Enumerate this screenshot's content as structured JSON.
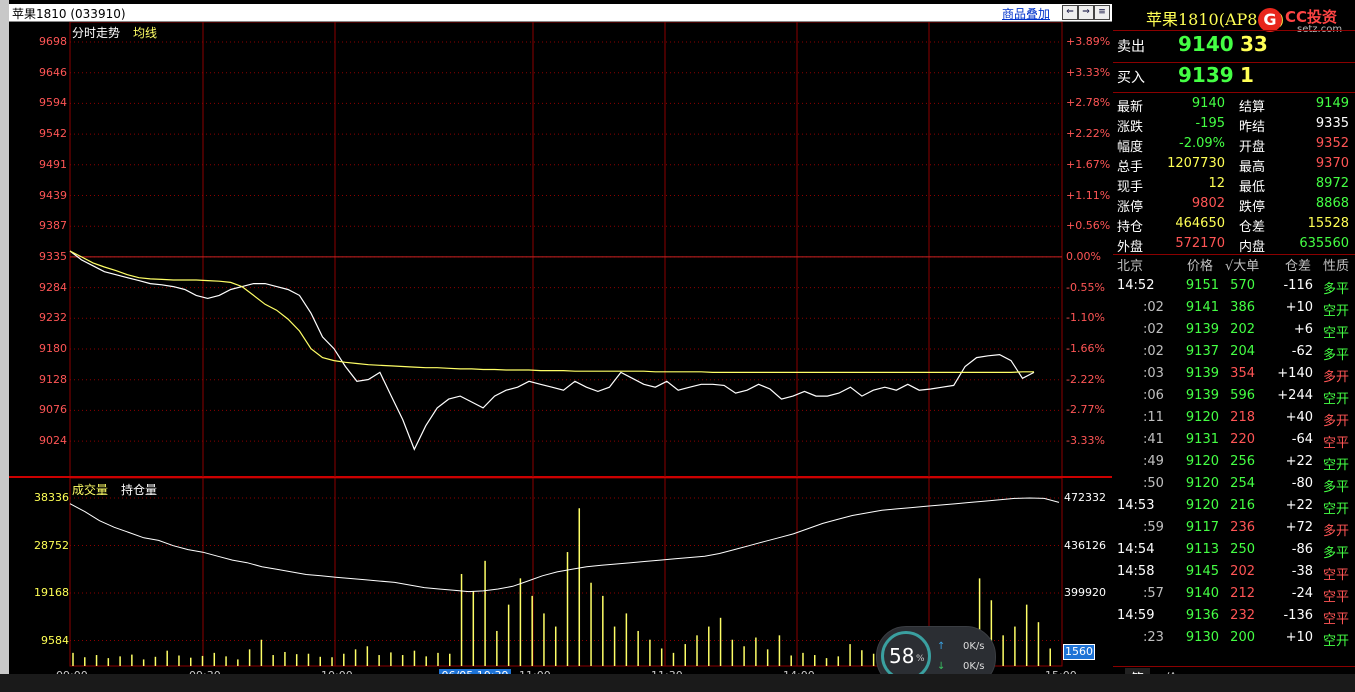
{
  "window": {
    "title": "苹果1810 (033910)",
    "overlay_label": "商品叠加"
  },
  "chart_tabs": {
    "tab1": "分时走势",
    "tab2": "均线",
    "vol_tab1": "成交量",
    "vol_tab2": "持仓量"
  },
  "colors": {
    "up": "#ff5555",
    "down": "#44ff44",
    "price_line": "#ffffff",
    "avg_line": "#ffff66",
    "grid": "#8b0000"
  },
  "price_axis": [
    "9698",
    "9646",
    "9594",
    "9542",
    "9491",
    "9439",
    "9387",
    "9335",
    "9284",
    "9232",
    "9180",
    "9128",
    "9076",
    "9024"
  ],
  "pct_axis": [
    "+3.89%",
    "+3.33%",
    "+2.78%",
    "+2.22%",
    "+1.67%",
    "+1.11%",
    "+0.56%",
    "0.00%",
    "-0.55%",
    "-1.10%",
    "-1.66%",
    "-2.22%",
    "-2.77%",
    "-3.33%"
  ],
  "volume_axis": [
    "38336",
    "28752",
    "19168",
    "9584"
  ],
  "oi_axis": [
    "472332",
    "436126",
    "399920"
  ],
  "cursor_value": "1560",
  "time_axis": [
    "09:00",
    "09:30",
    "10:00",
    "11:00",
    "11:30",
    "14:00",
    "15:00"
  ],
  "time_cursor": "06/05 10:39",
  "chart_data": {
    "type": "line",
    "title": "",
    "xlabel": "",
    "ylabel": "",
    "prev_settle": 9335,
    "ylim": [
      8992,
      9716
    ],
    "series": [
      {
        "name": "",
        "color": "#ffffff",
        "values": [
          9345,
          9330,
          9320,
          9310,
          9305,
          9300,
          9295,
          9290,
          9288,
          9285,
          9280,
          9270,
          9265,
          9270,
          9280,
          9285,
          9290,
          9290,
          9285,
          9280,
          9270,
          9240,
          9200,
          9180,
          9150,
          9125,
          9128,
          9140,
          9100,
          9060,
          9010,
          9050,
          9080,
          9095,
          9100,
          9090,
          9080,
          9100,
          9110,
          9115,
          9125,
          9120,
          9115,
          9110,
          9125,
          9115,
          9108,
          9115,
          9140,
          9130,
          9120,
          9115,
          9125,
          9110,
          9115,
          9120,
          9120,
          9118,
          9105,
          9110,
          9120,
          9112,
          9095,
          9100,
          9108,
          9100,
          9100,
          9105,
          9115,
          9100,
          9110,
          9115,
          9110,
          9120,
          9110,
          9112,
          9115,
          9118,
          9150,
          9165,
          9168,
          9170,
          9160,
          9130,
          9140
        ]
      },
      {
        "name": "",
        "color": "#ffff66",
        "values": [
          9345,
          9335,
          9325,
          9318,
          9312,
          9305,
          9300,
          9298,
          9297,
          9296,
          9296,
          9296,
          9295,
          9294,
          9292,
          9285,
          9270,
          9255,
          9245,
          9230,
          9210,
          9180,
          9165,
          9160,
          9157,
          9155,
          9153,
          9152,
          9151,
          9150,
          9149,
          9148,
          9148,
          9147,
          9146,
          9146,
          9145,
          9145,
          9144,
          9144,
          9144,
          9143,
          9143,
          9143,
          9142,
          9142,
          9142,
          9142,
          9142,
          9142,
          9142,
          9141,
          9141,
          9141,
          9141,
          9141,
          9140,
          9140,
          9140,
          9140,
          9140,
          9140,
          9140,
          9140,
          9140,
          9140,
          9140,
          9140,
          9140,
          9140,
          9140,
          9140,
          9140,
          9140,
          9140,
          9140,
          9140,
          9140,
          9140,
          9140,
          9140,
          9140,
          9140,
          9141,
          9141
        ]
      }
    ],
    "oi_values": [
      468000,
      462000,
      455000,
      450000,
      446000,
      442000,
      440000,
      436000,
      433000,
      431000,
      428000,
      425000,
      423000,
      420000,
      418000,
      416000,
      414000,
      413000,
      412000,
      411000,
      410000,
      409000,
      408000,
      406000,
      404000,
      403000,
      402000,
      401000,
      401500,
      403000,
      405000,
      409000,
      413000,
      416000,
      418000,
      420000,
      421000,
      422000,
      423000,
      424000,
      425000,
      426000,
      427000,
      428000,
      430000,
      433000,
      436000,
      439000,
      442000,
      445000,
      449000,
      453000,
      456000,
      459000,
      461000,
      463000,
      464000,
      465000,
      466000,
      467000,
      468000,
      469000,
      470000,
      471000,
      472000,
      472332,
      472000,
      469000
    ],
    "volumes": [
      3000,
      2000,
      2500,
      1800,
      2200,
      2600,
      1500,
      2100,
      3500,
      2400,
      1900,
      2300,
      3000,
      2200,
      1500,
      3800,
      6000,
      2500,
      3200,
      2700,
      2800,
      2100,
      2000,
      2800,
      3800,
      4500,
      2500,
      3100,
      2500,
      3500,
      2200,
      3000,
      2800,
      21000,
      17000,
      24000,
      8000,
      14000,
      20000,
      16000,
      12000,
      9000,
      26000,
      36000,
      19000,
      16000,
      9000,
      12000,
      8000,
      6000,
      4000,
      3000,
      5000,
      7000,
      9000,
      11000,
      6000,
      4500,
      6500,
      3800,
      7000,
      2400,
      3000,
      2500,
      1800,
      2200,
      5000,
      3600,
      2800,
      2200,
      3000,
      4000,
      8000,
      6000,
      3500,
      2700,
      4000,
      20000,
      15000,
      7000,
      9000,
      14000,
      10000,
      4000
    ]
  },
  "quote_panel": {
    "title": "苹果1810(AP810)",
    "logo_text": "CC投资",
    "logo_sub": "setz.com",
    "sell_label": "卖出",
    "sell_price": "9140",
    "sell_vol": "33",
    "buy_label": "买入",
    "buy_price": "9139",
    "buy_vol": "1",
    "stats": [
      {
        "l1": "最新",
        "v1": "9140",
        "c1": "g",
        "l2": "结算",
        "v2": "9149",
        "c2": "g"
      },
      {
        "l1": "涨跌",
        "v1": "-195",
        "c1": "g",
        "l2": "昨结",
        "v2": "9335",
        "c2": "w"
      },
      {
        "l1": "幅度",
        "v1": "-2.09%",
        "c1": "g",
        "l2": "开盘",
        "v2": "9352",
        "c2": "r"
      },
      {
        "l1": "总手",
        "v1": "1207730",
        "c1": "y",
        "l2": "最高",
        "v2": "9370",
        "c2": "r"
      },
      {
        "l1": "现手",
        "v1": "12",
        "c1": "y",
        "l2": "最低",
        "v2": "8972",
        "c2": "g"
      },
      {
        "l1": "涨停",
        "v1": "9802",
        "c1": "r",
        "l2": "跌停",
        "v2": "8868",
        "c2": "g"
      },
      {
        "l1": "持仓",
        "v1": "464650",
        "c1": "y",
        "l2": "仓差",
        "v2": "15528",
        "c2": "y"
      },
      {
        "l1": "外盘",
        "v1": "572170",
        "c1": "r",
        "l2": "内盘",
        "v2": "635560",
        "c2": "g"
      }
    ],
    "tick_headers": [
      "北京",
      "价格",
      "√大单",
      "仓差",
      "性质"
    ],
    "ticks": [
      {
        "t": "14:52",
        "p": "9151",
        "v": "570",
        "d": "-116",
        "n": "多平",
        "pc": "g",
        "dc": "w",
        "nc": "g"
      },
      {
        "t": ":02",
        "p": "9141",
        "v": "386",
        "d": "+10",
        "n": "空开",
        "pc": "g",
        "dc": "w",
        "nc": "g"
      },
      {
        "t": ":02",
        "p": "9139",
        "v": "202",
        "d": "+6",
        "n": "空平",
        "pc": "g",
        "dc": "w",
        "nc": "g"
      },
      {
        "t": ":02",
        "p": "9137",
        "v": "204",
        "d": "-62",
        "n": "多平",
        "pc": "g",
        "dc": "w",
        "nc": "g"
      },
      {
        "t": ":03",
        "p": "9139",
        "v": "354",
        "d": "+140",
        "n": "多开",
        "pc": "g",
        "dc": "w",
        "nc": "r",
        "vc": "r"
      },
      {
        "t": ":06",
        "p": "9139",
        "v": "596",
        "d": "+244",
        "n": "空开",
        "pc": "g",
        "dc": "w",
        "nc": "g"
      },
      {
        "t": ":11",
        "p": "9120",
        "v": "218",
        "d": "+40",
        "n": "多开",
        "pc": "g",
        "dc": "w",
        "nc": "r",
        "vc": "r"
      },
      {
        "t": ":41",
        "p": "9131",
        "v": "220",
        "d": "-64",
        "n": "空平",
        "pc": "g",
        "dc": "w",
        "nc": "r",
        "vc": "r"
      },
      {
        "t": ":49",
        "p": "9120",
        "v": "256",
        "d": "+22",
        "n": "空开",
        "pc": "g",
        "dc": "w",
        "nc": "g"
      },
      {
        "t": ":50",
        "p": "9120",
        "v": "254",
        "d": "-80",
        "n": "多平",
        "pc": "g",
        "dc": "w",
        "nc": "g"
      },
      {
        "t": "14:53",
        "p": "9120",
        "v": "216",
        "d": "+22",
        "n": "空开",
        "pc": "g",
        "dc": "w",
        "nc": "g"
      },
      {
        "t": ":59",
        "p": "9117",
        "v": "236",
        "d": "+72",
        "n": "多开",
        "pc": "g",
        "dc": "w",
        "nc": "r",
        "vc": "r"
      },
      {
        "t": "14:54",
        "p": "9113",
        "v": "250",
        "d": "-86",
        "n": "多平",
        "pc": "g",
        "dc": "w",
        "nc": "g"
      },
      {
        "t": "14:58",
        "p": "9145",
        "v": "202",
        "d": "-38",
        "n": "空平",
        "pc": "g",
        "dc": "w",
        "nc": "r",
        "vc": "r"
      },
      {
        "t": ":57",
        "p": "9140",
        "v": "212",
        "d": "-24",
        "n": "空平",
        "pc": "g",
        "dc": "w",
        "nc": "r",
        "vc": "r"
      },
      {
        "t": "14:59",
        "p": "9136",
        "v": "232",
        "d": "-136",
        "n": "空平",
        "pc": "g",
        "dc": "w",
        "nc": "r",
        "vc": "r"
      },
      {
        "t": ":23",
        "p": "9130",
        "v": "200",
        "d": "+10",
        "n": "空开",
        "pc": "g",
        "dc": "w",
        "nc": "g"
      }
    ],
    "bottom_tabs": [
      "笔",
      "价"
    ]
  },
  "speed_widget": {
    "percent": "58",
    "unit": "%",
    "up": "0K/s",
    "down": "0K/s"
  }
}
